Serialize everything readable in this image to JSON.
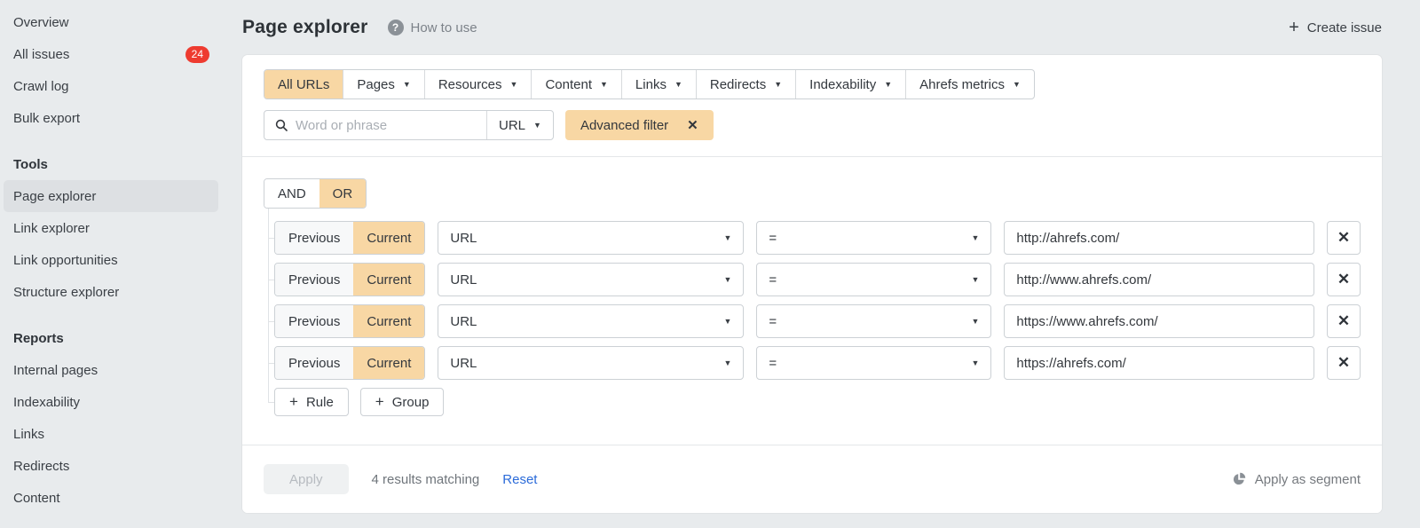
{
  "header": {
    "title": "Page explorer",
    "help_label": "How to use",
    "create_issue_label": "Create issue"
  },
  "sidebar": {
    "top_items": [
      {
        "label": "Overview"
      },
      {
        "label": "All issues",
        "badge": "24"
      },
      {
        "label": "Crawl log"
      },
      {
        "label": "Bulk export"
      }
    ],
    "tools_heading": "Tools",
    "tools_items": [
      {
        "label": "Page explorer",
        "active": true
      },
      {
        "label": "Link explorer"
      },
      {
        "label": "Link opportunities"
      },
      {
        "label": "Structure explorer"
      }
    ],
    "reports_heading": "Reports",
    "reports_items": [
      {
        "label": "Internal pages"
      },
      {
        "label": "Indexability"
      },
      {
        "label": "Links"
      },
      {
        "label": "Redirects"
      },
      {
        "label": "Content"
      }
    ]
  },
  "filter_tabs": {
    "tabs": [
      {
        "label": "All URLs",
        "active": true,
        "dropdown": false
      },
      {
        "label": "Pages",
        "dropdown": true
      },
      {
        "label": "Resources",
        "dropdown": true
      },
      {
        "label": "Content",
        "dropdown": true
      },
      {
        "label": "Links",
        "dropdown": true
      },
      {
        "label": "Redirects",
        "dropdown": true
      },
      {
        "label": "Indexability",
        "dropdown": true
      },
      {
        "label": "Ahrefs metrics",
        "dropdown": true
      }
    ]
  },
  "search": {
    "placeholder": "Word or phrase",
    "scope": "URL",
    "advanced_label": "Advanced filter"
  },
  "builder": {
    "and_label": "AND",
    "or_label": "OR",
    "active_operator": "OR",
    "prev_label": "Previous",
    "curr_label": "Current",
    "active_toggle": "Current",
    "rules": [
      {
        "field": "URL",
        "operator": "=",
        "value": "http://ahrefs.com/"
      },
      {
        "field": "URL",
        "operator": "=",
        "value": "http://www.ahrefs.com/"
      },
      {
        "field": "URL",
        "operator": "=",
        "value": "https://www.ahrefs.com/"
      },
      {
        "field": "URL",
        "operator": "=",
        "value": "https://ahrefs.com/"
      }
    ],
    "add_rule_label": "Rule",
    "add_group_label": "Group"
  },
  "footer": {
    "apply_label": "Apply",
    "results_text": "4 results matching",
    "reset_label": "Reset",
    "segment_label": "Apply as segment"
  },
  "icons": {
    "plus": "+",
    "close": "✕",
    "dropdown_arrow": "▼",
    "question": "?"
  },
  "colors": {
    "accent_orange": "#f8d7a4",
    "badge_red": "#ee3b30",
    "link_blue": "#2b6bd9",
    "page_bg": "#e8ebed"
  }
}
